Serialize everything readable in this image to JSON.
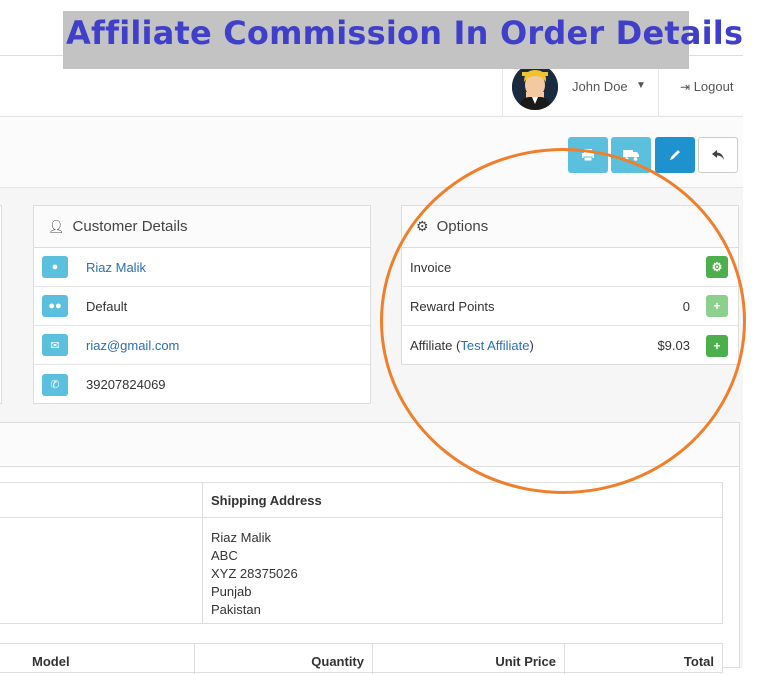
{
  "banner": {
    "title": "Affiliate Commission In Order Details"
  },
  "header": {
    "user_name": "John Doe",
    "logout_label": "Logout"
  },
  "toolbar": {
    "buttons": [
      {
        "name": "print-invoice",
        "color": "#5bc0de"
      },
      {
        "name": "print-shipping",
        "color": "#5bc0de"
      },
      {
        "name": "edit",
        "color": "#1e91cf"
      },
      {
        "name": "back",
        "color": "#ffffff"
      }
    ]
  },
  "customer": {
    "heading": "Customer Details",
    "name": "Riaz Malik",
    "group": "Default",
    "email": "riaz@gmail.com",
    "telephone": "39207824069"
  },
  "options": {
    "heading": "Options",
    "invoice_label": "Invoice",
    "reward_label": "Reward Points",
    "reward_value": "0",
    "affiliate_prefix": "Affiliate (",
    "affiliate_name": "Test Affiliate",
    "affiliate_suffix": ")",
    "affiliate_value": "$9.03"
  },
  "address": {
    "shipping_heading": "Shipping Address",
    "lines": [
      "Riaz Malik",
      "ABC",
      "XYZ 28375026",
      "Punjab",
      "Pakistan"
    ]
  },
  "products": {
    "headers": [
      "Model",
      "Quantity",
      "Unit Price",
      "Total"
    ]
  },
  "colors": {
    "highlight_circle": "#f07f2c",
    "banner_text": "#3f3fc9",
    "info": "#5bc0de",
    "success": "#4cae4c"
  }
}
